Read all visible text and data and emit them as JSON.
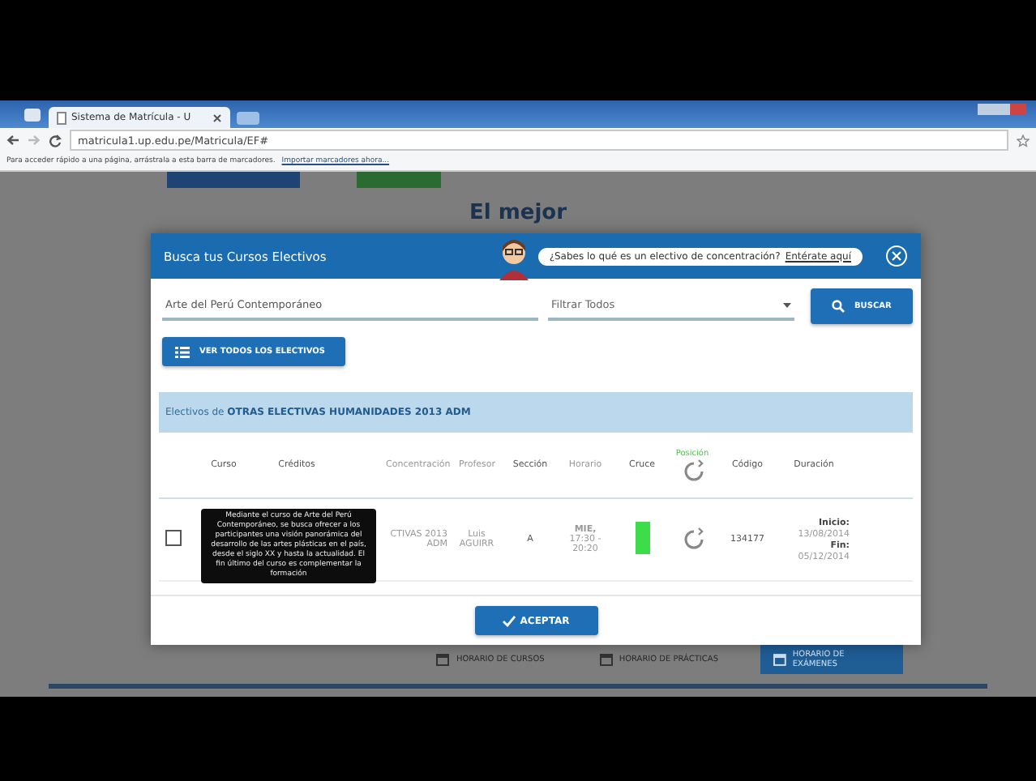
{
  "browser": {
    "tab_title": "Sistema de Matrícula - U",
    "address": "matricula1.up.edu.pe/Matricula/EF#",
    "bookmarks_hint": "Para acceder rápido a una página, arrástrala a esta barra de marcadores.",
    "bookmarks_link": "Importar marcadores ahora..."
  },
  "page": {
    "heading": "El mejor",
    "footer_buttons": [
      {
        "label": "HORARIO DE CURSOS",
        "selected": false
      },
      {
        "label": "HORARIO DE PRÁCTICAS",
        "selected": false
      },
      {
        "label": "HORARIO DE EXÁMENES",
        "selected": true
      }
    ]
  },
  "modal": {
    "title": "Busca tus Cursos Electivos",
    "help_text": "¿Sabes lo qué es un electivo de concentración?",
    "help_link": "Entérate aquí",
    "search_value": "Arte del Perú Contemporáneo",
    "filter_value": "Filtrar Todos",
    "search_button": "BUSCAR",
    "all_button": "VER TODOS LOS ELECTIVOS",
    "panel_title": "Electivos de **OTRAS ELECTIVAS HUMANIDADES 2013 ADM**",
    "columns": [
      {
        "label": "Curso",
        "kind": "text"
      },
      {
        "label": "Créditos",
        "kind": "text"
      },
      {
        "label": "Concentración",
        "kind": "text"
      },
      {
        "label": "Profesor",
        "kind": "text"
      },
      {
        "label": "Sección",
        "kind": "text"
      },
      {
        "label": "Horario",
        "kind": "text"
      },
      {
        "label": "Cruce",
        "kind": "text"
      },
      {
        "label": "Posición",
        "kind": "icon"
      },
      {
        "label": "Código",
        "kind": "text"
      },
      {
        "label": "Duración",
        "kind": "text"
      }
    ],
    "rows": [
      {
        "checked": false,
        "concentracion": "CTIVAS 2013 ADM",
        "profesor": "Luis AGUIRR",
        "seccion": "A",
        "horario_day": "MIE,",
        "horario_time": "17:30 - 20:20",
        "conflict": false,
        "codigo": "134177",
        "inicio_label": "Inicio:",
        "inicio": "13/08/2014",
        "fin_label": "Fin:",
        "fin": "05/12/2014"
      }
    ],
    "tooltip": "Mediante el curso de Arte del Perú Contemporáneo, se busca ofrecer a los participantes una visión panorámica del desarrollo de las artes plásticas en el país, desde el siglo XX y hasta la actualidad. El fin último del curso es complementar la formación",
    "accept_button": "ACEPTAR"
  }
}
